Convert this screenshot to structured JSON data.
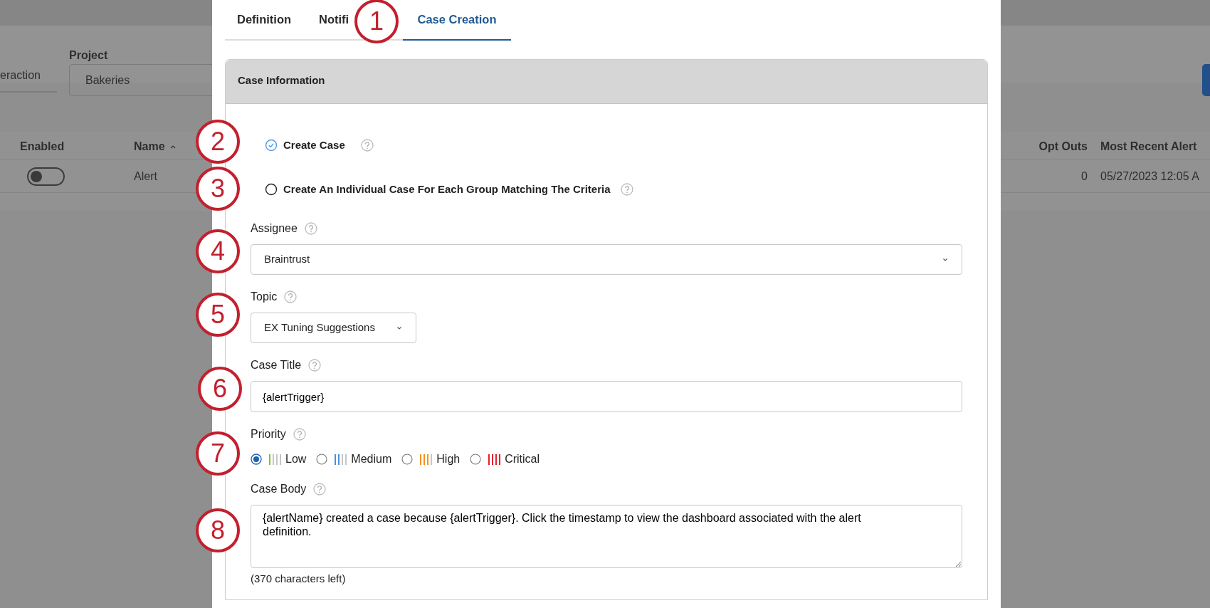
{
  "background_page": {
    "tab_label": "eraction",
    "project": {
      "label": "Project",
      "value": "Bakeries"
    },
    "table": {
      "columns": [
        {
          "label": "Enabled",
          "sorted": false
        },
        {
          "label": "Name",
          "sorted": true
        },
        {
          "label": "Opt Outs",
          "sorted": false
        },
        {
          "label": "Most Recent Alert",
          "sorted": false
        }
      ],
      "rows": [
        {
          "enabled": false,
          "name": "Alert",
          "opt_outs": "0",
          "most_recent_alert": "05/27/2023 12:05 A"
        }
      ]
    }
  },
  "tabs": [
    {
      "label": "Definition",
      "selected": false
    },
    {
      "label": "Notifi",
      "selected": false
    },
    {
      "label": "Case Creation",
      "selected": true
    }
  ],
  "section": {
    "title": "Case Information",
    "options": [
      {
        "label": "Create Case",
        "checked": true
      },
      {
        "label": "Create An Individual Case For Each Group Matching The Criteria",
        "checked": false
      }
    ],
    "fields": [
      {
        "kind": "select",
        "label": "Assignee",
        "value": "Braintrust"
      },
      {
        "kind": "dropdown",
        "label": "Topic",
        "value": "EX Tuning Suggestions"
      },
      {
        "kind": "text",
        "label": "Case Title",
        "value": "{alertTrigger}"
      },
      {
        "kind": "priority",
        "label": "Priority",
        "options": [
          {
            "label": "Low",
            "selected": true,
            "color": "#7cc13a",
            "level": 0.25
          },
          {
            "label": "Medium",
            "selected": false,
            "color": "#4a90e2",
            "level": 0.5
          },
          {
            "label": "High",
            "selected": false,
            "color": "#f39221",
            "level": 0.75
          },
          {
            "label": "Critical",
            "selected": false,
            "color": "#e8202a",
            "level": 1
          }
        ]
      },
      {
        "kind": "textarea",
        "label": "Case Body",
        "value": "{alertName} created a case because {alertTrigger}. Click the timestamp to view the dashboard associated with the alert definition.",
        "hint": "(370 characters left)"
      }
    ]
  },
  "callouts": [
    "1",
    "2",
    "3",
    "4",
    "5",
    "6",
    "7",
    "8"
  ]
}
